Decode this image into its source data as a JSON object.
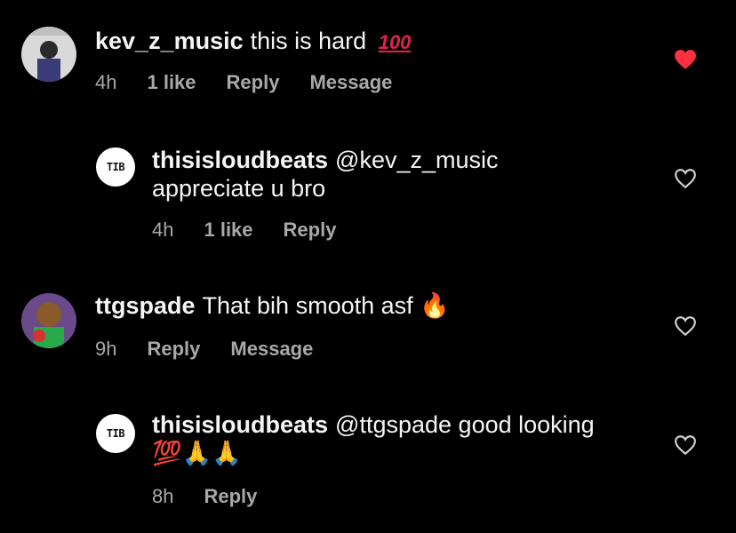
{
  "comments": [
    {
      "username": "kev_z_music",
      "text": "this is hard",
      "emoji": "💯",
      "time": "4h",
      "likes": "1 like",
      "reply": "Reply",
      "message": "Message",
      "liked": true
    },
    {
      "username": "thisisloudbeats",
      "mention": "@kev_z_music",
      "text": "appreciate u bro",
      "time": "4h",
      "likes": "1 like",
      "reply": "Reply",
      "avatar_text": "TIB",
      "liked": false
    },
    {
      "username": "ttgspade",
      "text": "That bih smooth asf",
      "emoji": "🔥",
      "time": "9h",
      "reply": "Reply",
      "message": "Message",
      "liked": false
    },
    {
      "username": "thisisloudbeats",
      "mention": "@ttgspade",
      "text": "good looking",
      "emoji": "💯🙏🙏",
      "time": "8h",
      "reply": "Reply",
      "avatar_text": "TIB",
      "liked": false
    }
  ],
  "colors": {
    "heart_liked": "#ff3040",
    "meta": "#a8a8a8",
    "mention": "#e0e6ff"
  }
}
